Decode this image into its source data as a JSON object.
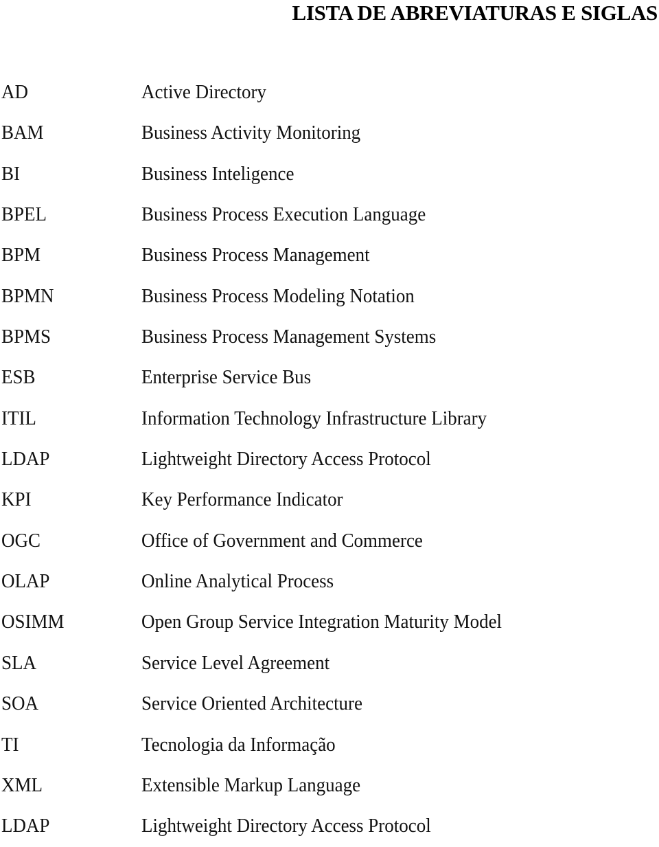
{
  "document": {
    "title": "LISTA DE ABREVIATURAS E SIGLAS",
    "entries": [
      {
        "term": "AD",
        "definition": "Active Directory"
      },
      {
        "term": "BAM",
        "definition": "Business Activity Monitoring"
      },
      {
        "term": "BI",
        "definition": "Business Inteligence"
      },
      {
        "term": "BPEL",
        "definition": "Business Process Execution Language"
      },
      {
        "term": "BPM",
        "definition": "Business Process Management"
      },
      {
        "term": "BPMN",
        "definition": "Business Process Modeling Notation"
      },
      {
        "term": "BPMS",
        "definition": "Business Process Management Systems"
      },
      {
        "term": "ESB",
        "definition": "Enterprise Service Bus"
      },
      {
        "term": "ITIL",
        "definition": "Information Technology Infrastructure Library"
      },
      {
        "term": "LDAP",
        "definition": "Lightweight Directory Access Protocol"
      },
      {
        "term": "KPI",
        "definition": "Key Performance Indicator"
      },
      {
        "term": "OGC",
        "definition": "Office of Government and Commerce"
      },
      {
        "term": "OLAP",
        "definition": "Online Analytical Process"
      },
      {
        "term": "OSIMM",
        "definition": "Open Group Service Integration Maturity Model"
      },
      {
        "term": "SLA",
        "definition": "Service Level Agreement"
      },
      {
        "term": "SOA",
        "definition": "Service Oriented Architecture"
      },
      {
        "term": "TI",
        "definition": "Tecnologia da Informação"
      },
      {
        "term": "XML",
        "definition": "Extensible Markup Language"
      },
      {
        "term": "LDAP",
        "definition": "Lightweight Directory Access Protocol"
      }
    ]
  }
}
